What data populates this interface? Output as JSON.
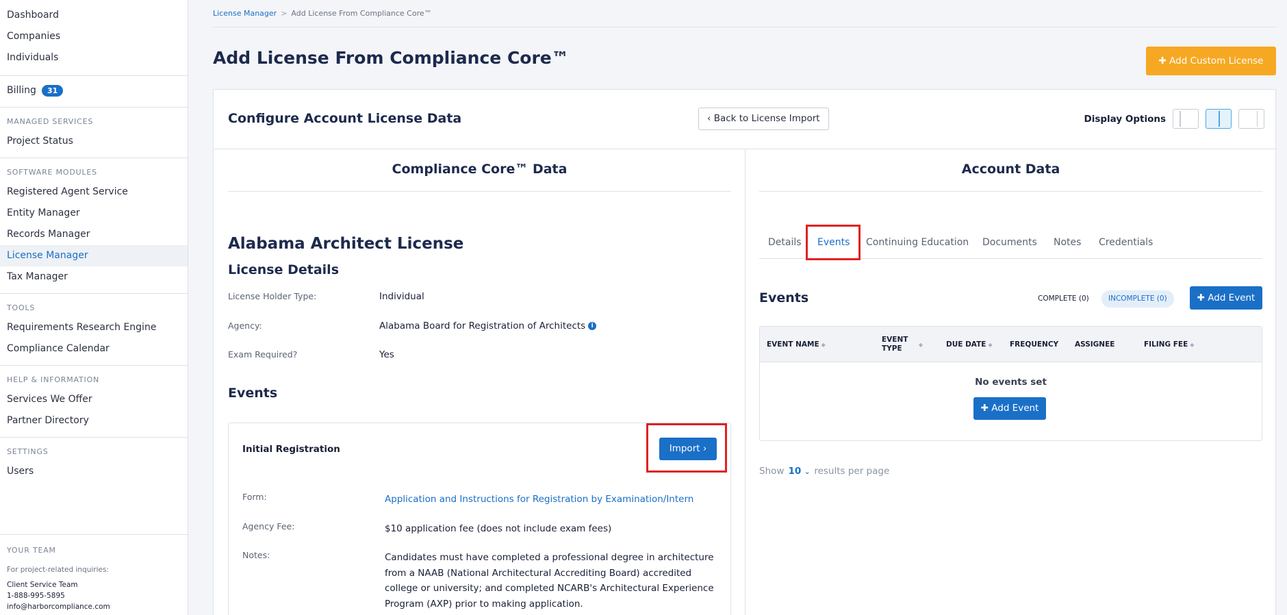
{
  "sidebar": {
    "group1": [
      "Dashboard",
      "Companies",
      "Individuals"
    ],
    "billing": {
      "label": "Billing",
      "badge": "31"
    },
    "managed_services": {
      "heading": "MANAGED SERVICES",
      "items": [
        "Project Status"
      ]
    },
    "software_modules": {
      "heading": "SOFTWARE MODULES",
      "items": [
        "Registered Agent Service",
        "Entity Manager",
        "Records Manager",
        "License Manager",
        "Tax Manager"
      ]
    },
    "tools": {
      "heading": "TOOLS",
      "items": [
        "Requirements Research Engine",
        "Compliance Calendar"
      ]
    },
    "help": {
      "heading": "HELP & INFORMATION",
      "items": [
        "Services We Offer",
        "Partner Directory"
      ]
    },
    "settings": {
      "heading": "SETTINGS",
      "items": [
        "Users"
      ]
    },
    "team": {
      "heading": "YOUR TEAM",
      "note": "For project-related inquiries:",
      "name": "Client Service Team",
      "phone": "1-888-995-5895",
      "email": "info@harborcompliance.com"
    }
  },
  "breadcrumb": {
    "parent": "License Manager",
    "sep": ">",
    "current": "Add License From Compliance Core™"
  },
  "page": {
    "title": "Add License From Compliance Core™",
    "custom_button": "Add Custom License"
  },
  "config": {
    "title": "Configure Account License Data",
    "back_button": "Back to License Import",
    "display_options_label": "Display Options"
  },
  "left": {
    "heading": "Compliance Core™ Data",
    "license_name": "Alabama Architect License",
    "details_heading": "License Details",
    "details": [
      {
        "key": "License Holder Type:",
        "value": "Individual"
      },
      {
        "key": "Agency:",
        "value": "Alabama Board for Registration of Architects"
      },
      {
        "key": "Exam Required?",
        "value": "Yes"
      }
    ],
    "events_heading": "Events",
    "event": {
      "title": "Initial Registration",
      "import_label": "Import",
      "form_key": "Form:",
      "form_value": "Application and Instructions for Registration by Examination/Intern",
      "fee_key": "Agency Fee:",
      "fee_value": "$10 application fee (does not include exam fees)",
      "notes_key": "Notes:",
      "notes_value": "Candidates must have completed a professional degree in architecture from a NAAB (National Architectural Accrediting Board) accredited college or university; and completed NCARB's Architectural Experience Program (AXP) prior to making application."
    }
  },
  "right": {
    "heading": "Account Data",
    "tabs": [
      "Details",
      "Events",
      "Continuing Education",
      "Documents",
      "Notes",
      "Credentials"
    ],
    "active_tab": "Events",
    "events_title": "Events",
    "filter_complete": "COMPLETE (0)",
    "filter_incomplete": "INCOMPLETE (0)",
    "add_event": "Add Event",
    "columns": [
      "EVENT NAME",
      "EVENT TYPE",
      "DUE DATE",
      "FREQUENCY",
      "ASSIGNEE",
      "FILING FEE"
    ],
    "empty_message": "No events set",
    "show_label": "Show",
    "per_page_value": "10",
    "per_page_suffix": "results per page"
  },
  "colors": {
    "primary": "#1a6fc7",
    "accent": "#f7a823",
    "highlight": "#e02121"
  }
}
